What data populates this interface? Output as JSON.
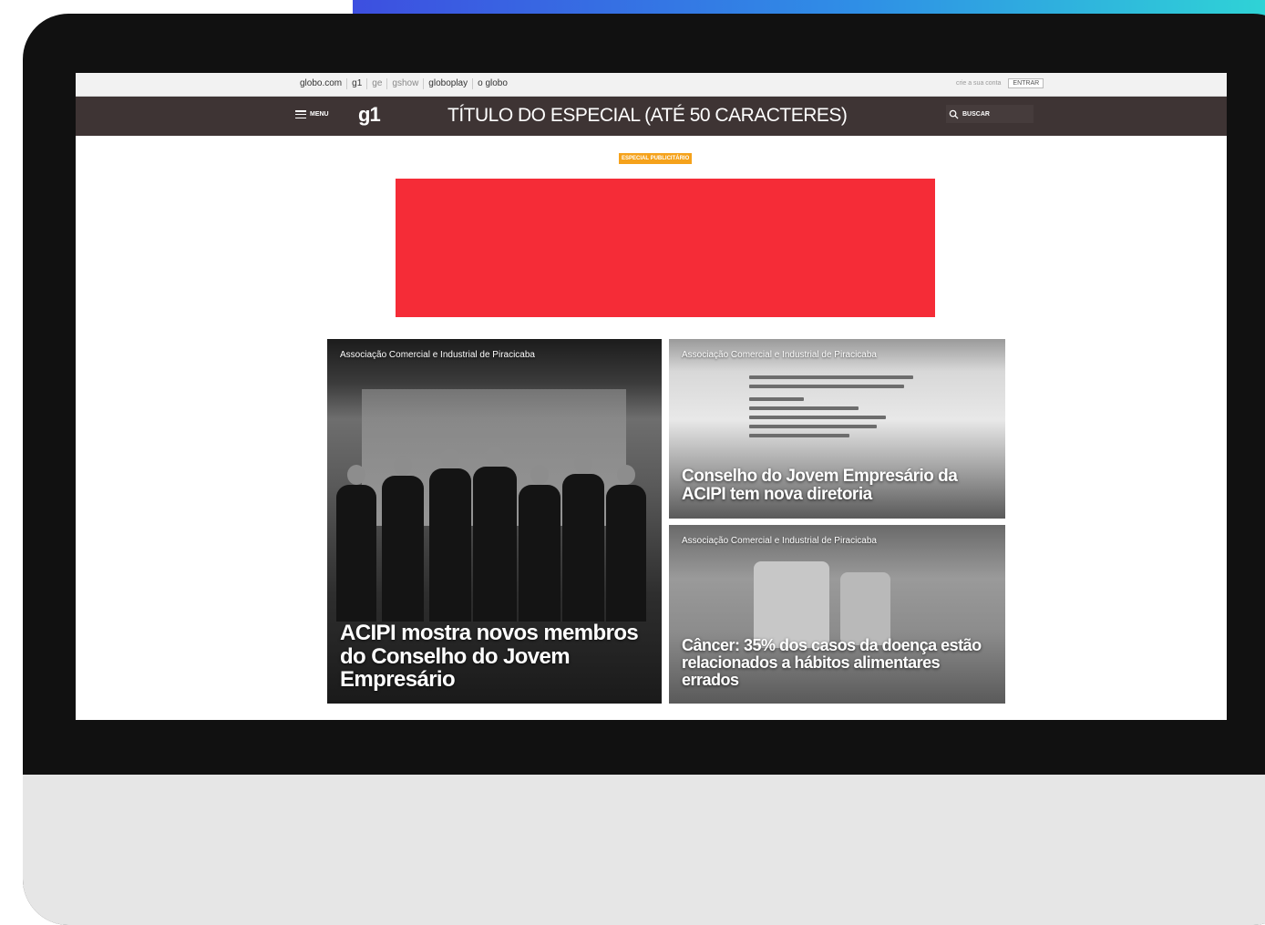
{
  "globo_bar": {
    "links": [
      "globo.com",
      "g1",
      "ge",
      "gshow",
      "globoplay",
      "o globo"
    ],
    "create_account": "crie a sua conta",
    "login": "ENTRAR"
  },
  "header": {
    "menu_label": "MENU",
    "logo": "g1",
    "title": "TÍTULO DO ESPECIAL (ATÉ 50 CARACTERES)",
    "search_label": "BUSCAR"
  },
  "badge": "ESPECIAL PUBLICITÁRIO",
  "colors": {
    "banner": "#f52c37",
    "header_bg": "#3e3434",
    "badge": "#f5a21b"
  },
  "cards": [
    {
      "source": "Associação Comercial e Industrial de Piracicaba",
      "headline": "ACIPI mostra novos membros do Conselho do Jovem Empresário"
    },
    {
      "source": "Associação Comercial e Industrial de Piracicaba",
      "headline": "Conselho do Jovem Empresário da ACIPI tem nova diretoria"
    },
    {
      "source": "Associação Comercial e Industrial de Piracicaba",
      "headline": "Câncer: 35% dos casos da doença estão relacionados a hábitos alimentares errados"
    }
  ]
}
